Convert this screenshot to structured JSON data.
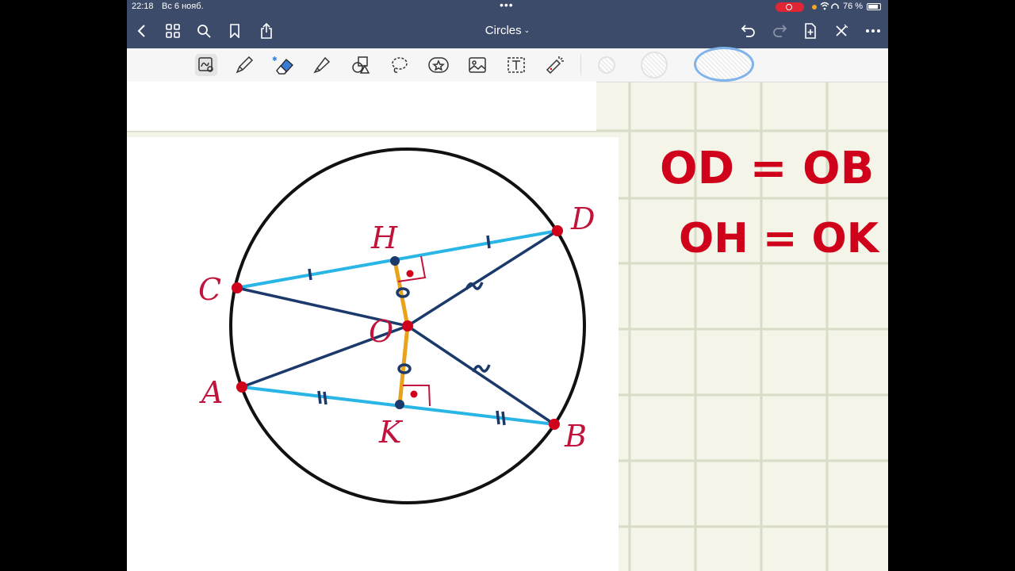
{
  "status_bar": {
    "time": "22:18",
    "date": "Вс 6 нояб.",
    "battery": "76 %"
  },
  "nav": {
    "title": "Circles",
    "icons": [
      "back-chevron-icon",
      "grid-icon",
      "search-icon",
      "bookmark-icon",
      "share-icon",
      "undo-icon",
      "redo-icon",
      "add-page-icon",
      "close-pen-icon",
      "more-icon"
    ]
  },
  "toolbar": {
    "tools": [
      "lasso-select-icon",
      "pen-icon",
      "eraser-icon",
      "highlighter-icon",
      "shapes-icon",
      "lasso-icon",
      "sticker-icon",
      "image-icon",
      "text-icon",
      "laser-pointer-icon"
    ],
    "accent": "#3a7bd5"
  },
  "figure": {
    "labels": {
      "H": "H",
      "D": "D",
      "C": "C",
      "O": "O",
      "A": "A",
      "K": "K",
      "B": "B"
    },
    "colors": {
      "circle": "#111111",
      "chord": "#29b6e6",
      "radius": "#1b3a6b",
      "perpendicular": "#e8a21b",
      "points": "#d0021b"
    }
  },
  "ink": {
    "line1": "OD = OB",
    "line2": "OH = OK",
    "color": "#d0021b"
  }
}
